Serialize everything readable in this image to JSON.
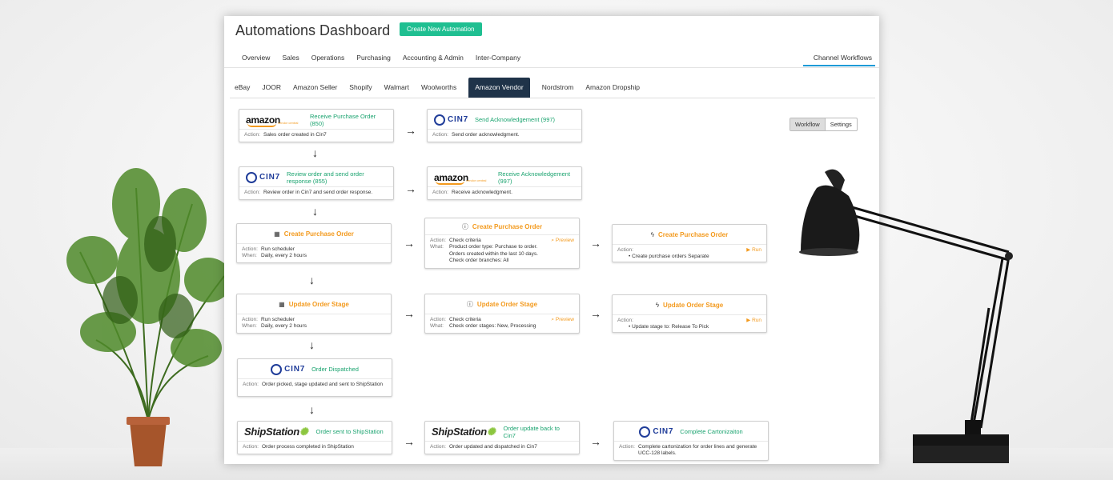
{
  "header": {
    "title": "Automations Dashboard",
    "create_label": "Create New Automation",
    "nav": [
      "Overview",
      "Sales",
      "Operations",
      "Purchasing",
      "Accounting & Admin",
      "Inter-Company"
    ],
    "nav_right": "Channel Workflows"
  },
  "subtabs": [
    "eBay",
    "JOOR",
    "Amazon Seller",
    "Shopify",
    "Walmart",
    "Woolworths",
    "Amazon Vendor",
    "Nordstrom",
    "Amazon Dropship"
  ],
  "subtab_active": "Amazon Vendor",
  "view_toggle": {
    "workflow": "Workflow",
    "settings": "Settings"
  },
  "labels": {
    "action": "Action:",
    "when": "When:",
    "what": "What:",
    "preview": "Preview",
    "run": "Run"
  },
  "logos": {
    "amazon": "amazon",
    "amazon_sub": "vendor central",
    "cin7": "CIN7",
    "shipstation": "ShipStation"
  },
  "cards": {
    "c1": {
      "title": "Receive Purchase Order (850)",
      "action": "Sales order created in Cin7"
    },
    "c2": {
      "title": "Send Acknowledgement (997)",
      "action": "Send order acknowledgment."
    },
    "c3": {
      "title": "Review order and send order response (855)",
      "action": "Review order in Cin7 and send order response."
    },
    "c4": {
      "title": "Receive Acknowledgement (997)",
      "action": "Receive acknowledgment."
    },
    "c5": {
      "title": "Create Purchase Order",
      "action": "Run scheduler",
      "when": "Daily, every 2 hours"
    },
    "c6": {
      "title": "Create Purchase Order",
      "action": "Check criteria",
      "what": [
        "Product order type: Purchase to order.",
        "Orders created within the last 10 days.",
        "Check order branches: All"
      ]
    },
    "c7": {
      "title": "Create Purchase Order",
      "bullet": "Create purchase orders Separate"
    },
    "c8": {
      "title": "Update Order Stage",
      "action": "Run scheduler",
      "when": "Daily, every 2 hours"
    },
    "c9": {
      "title": "Update Order Stage",
      "action": "Check criteria",
      "what": "Check order stages: New, Processing"
    },
    "c10": {
      "title": "Update Order Stage",
      "bullet": "Update stage to: Release To Pick"
    },
    "c11": {
      "title": "Order Dispatched",
      "action": "Order picked, stage updated and sent to ShipStation"
    },
    "c12": {
      "title": "Order sent to ShipStation",
      "action": "Order process completed in ShipStation"
    },
    "c13": {
      "title": "Order update back to Cin7",
      "action": "Order updated and dispatched in Cin7"
    },
    "c14": {
      "title": "Complete Cartonizaiton",
      "action": "Complete cartonization for order lines and generate UCC-128 labels."
    }
  },
  "colors": {
    "accent": "#1fbf91",
    "active_tab": "#1f3349",
    "orange": "#f39a1e",
    "cin7_blue": "#1f3c99",
    "nav_underline": "#1e9bd7"
  }
}
